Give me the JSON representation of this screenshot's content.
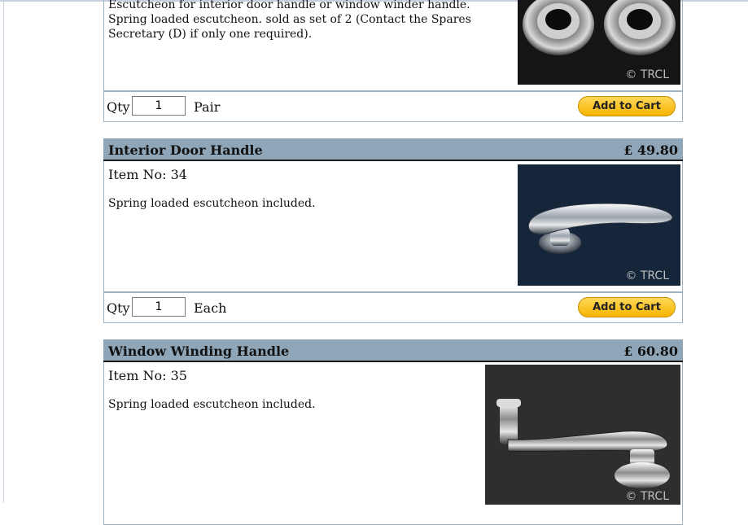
{
  "products": [
    {
      "description": "Escutcheon for interior door handle or window winder handle. Spring loaded escutcheon. sold as set of 2 (Contact the Spares Secretary (D) if only one required).",
      "copyright": "© TRCL",
      "qty_label": "Qty",
      "qty_value": "1",
      "unit": "Pair",
      "cart_label": "Add to Cart"
    },
    {
      "title": "Interior Door Handle",
      "price": "£ 49.80",
      "item_no": "Item No: 34",
      "description": "Spring loaded escutcheon included.",
      "copyright": "© TRCL",
      "qty_label": "Qty",
      "qty_value": "1",
      "unit": "Each",
      "cart_label": "Add to Cart"
    },
    {
      "title": "Window Winding Handle",
      "price": "£ 60.80",
      "item_no": "Item No: 35",
      "description": "Spring loaded escutcheon included.",
      "copyright": "© TRCL"
    }
  ],
  "colors": {
    "title_bar": "#8ea6b8",
    "cart_button": "#f7b400",
    "border": "#9fb3c2"
  }
}
